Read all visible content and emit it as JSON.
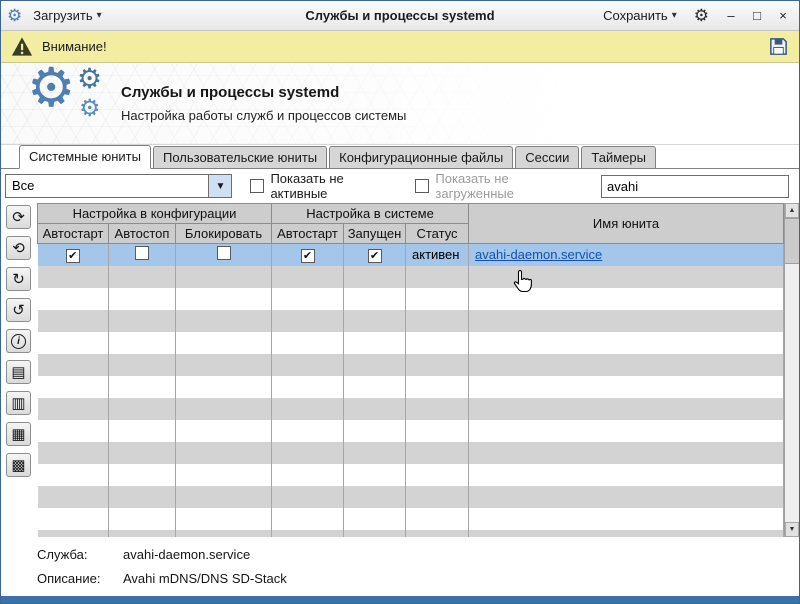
{
  "titlebar": {
    "load_label": "Загрузить",
    "title": "Службы и процессы systemd",
    "save_label": "Сохранить"
  },
  "warning": {
    "text": "Внимание!"
  },
  "header": {
    "title": "Службы и процессы systemd",
    "subtitle": "Настройка работы служб и процессов системы"
  },
  "tabs": {
    "items": [
      "Системные юниты",
      "Пользовательские юниты",
      "Конфигурационные файлы",
      "Сессии",
      "Таймеры"
    ]
  },
  "filters": {
    "combo_value": "Все",
    "show_inactive_label": "Показать не активные",
    "show_inactive_checked": false,
    "show_unloaded_label": "Показать не загруженные",
    "show_unloaded_checked": false,
    "search_value": "avahi"
  },
  "table": {
    "group1": "Настройка в конфигурации",
    "group2": "Настройка в системе",
    "unit_col": "Имя юнита",
    "cols": {
      "c1": "Автостарт",
      "c2": "Автостоп",
      "c3": "Блокировать",
      "c4": "Автостарт",
      "c5": "Запущен",
      "c6": "Статус"
    },
    "row": {
      "autostart_cfg": true,
      "autostop": false,
      "block": false,
      "autostart_sys": true,
      "running": true,
      "status": "активен",
      "unit": "avahi-daemon.service"
    }
  },
  "footer": {
    "service_label": "Служба:",
    "service_value": "avahi-daemon.service",
    "desc_label": "Описание:",
    "desc_value": "Avahi mDNS/DNS SD-Stack"
  },
  "icons": {
    "app_gear": "⚙",
    "settings_gear": "⚙",
    "dropdown_arrow": "▾",
    "combo_arrow": "▼",
    "minimize": "–",
    "maximize": "□",
    "close": "×",
    "gear_logo": "⚙",
    "checkmark": "✔",
    "scroll_up": "▲",
    "scroll_down": "▼",
    "toolbar": [
      "⟳",
      "⟲",
      "↻",
      "↺",
      "i",
      "▤",
      "▥",
      "▦",
      "▩"
    ]
  },
  "colors": {
    "selected_row": "#a3c6ea",
    "warning_bg": "#f2eda1",
    "link": "#1551b4",
    "gear_blue": "#4d7fb2",
    "window_accent": "#3e71a9"
  }
}
